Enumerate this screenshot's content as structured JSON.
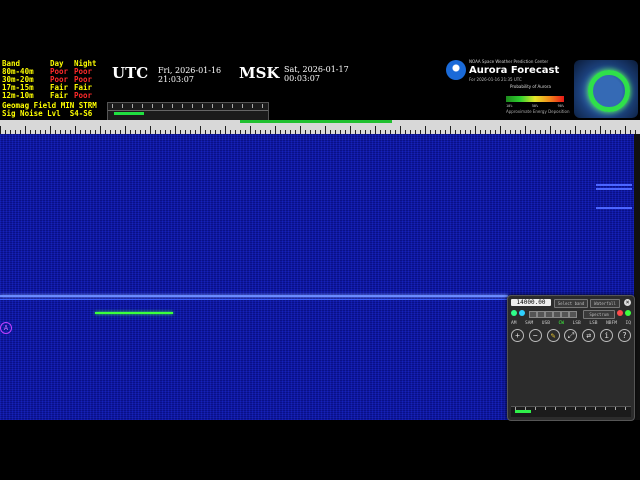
{
  "bands": {
    "header": [
      "Band",
      "Day",
      "Night"
    ],
    "rows": [
      {
        "band": "80m-40m",
        "day": "Poor",
        "night": "Poor"
      },
      {
        "band": "30m-20m",
        "day": "Poor",
        "night": "Poor"
      },
      {
        "band": "17m-15m",
        "day": "Fair",
        "night": "Fair"
      },
      {
        "band": "12m-10m",
        "day": "Fair",
        "night": "Poor"
      }
    ],
    "geomag_label": "Geomag Field",
    "geomag_value": "MIN STRM",
    "signoise_label": "Sig Noise Lvl",
    "signoise_value": "S4-S6",
    "colors": {
      "poor": "#ff2a2a",
      "fair": "#ffff00",
      "label": "#ffff00"
    }
  },
  "clocks": {
    "utc_label": "UTC",
    "utc_date": "Fri, 2026-01-16",
    "utc_time": "21:03:07",
    "msk_label": "MSK",
    "msk_date": "Sat, 2026-01-17",
    "msk_time": "00:03:07"
  },
  "aurora": {
    "agency": "NOAA Space Weather Prediction Center",
    "title": "Aurora Forecast",
    "forecast_time": "For 2026-01-16 21:35 UTC",
    "probability_label": "Probability of Aurora",
    "scale_labels": [
      "10%",
      "50%",
      "90%"
    ],
    "footnote": "Approximate Energy Deposition",
    "ring_color": "#2fe04a"
  },
  "panel": {
    "frequency": "14000.00",
    "selector_a": "Select band",
    "selector_b": "Waterfall",
    "mode_button": "Spectrum",
    "close_symbol": "×",
    "modes": [
      "AM",
      "SAM",
      "USB",
      "CW",
      "LSB",
      "LSB",
      "NBFM",
      "IQ"
    ],
    "active_mode": "CW",
    "icons": [
      "zoom-in",
      "zoom-out",
      "pen",
      "expand",
      "swap",
      "info",
      "help"
    ]
  },
  "waterfall": {
    "base_color": "#0b14a0",
    "signal_color": "#6a8cff",
    "marker_color": "#3cff3c",
    "marker_label": "A"
  }
}
